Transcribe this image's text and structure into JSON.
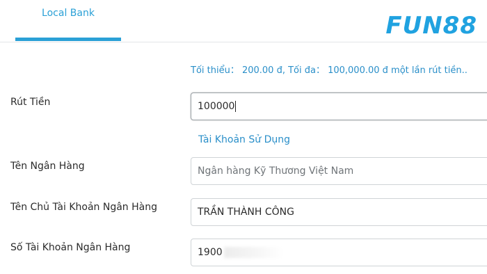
{
  "tab": {
    "label": "Local Bank"
  },
  "brand": {
    "logo_text": "FUN88",
    "accent": "#2aa0d6"
  },
  "limits_text": "Tối thiểu： 200.00 đ,  Tối đa： 100,000.00 đ một lần rút tiền..",
  "form": {
    "withdraw": {
      "label": "Rút Tiền",
      "value": "100000"
    },
    "account_link": "Tài Khoản Sử Dụng",
    "bank_name": {
      "label": "Tên Ngân Hàng",
      "placeholder": "Ngân hàng Kỹ Thương Việt Nam"
    },
    "holder_name": {
      "label": "Tên Chủ Tài Khoản Ngân Hàng",
      "value": "TRẦN THÀNH CÔNG"
    },
    "account_number": {
      "label": "Số Tài Khoản Ngân Hàng",
      "value": "1900"
    }
  }
}
